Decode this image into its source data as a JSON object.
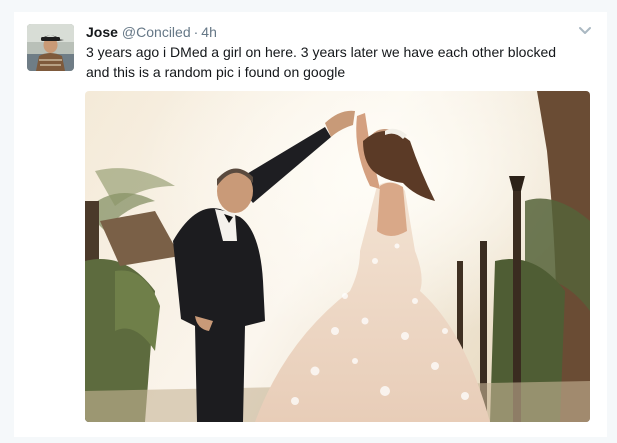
{
  "tweet": {
    "author_name": "Jose",
    "author_handle": "@Conciled",
    "separator": "·",
    "timestamp": "4h",
    "text_line_1": "3 years ago i DMed a girl on here. 3 years later we have each other blocked",
    "text_line_2": "and this is a random pic i found on google"
  },
  "icons": {
    "menu": "chevron-down-icon"
  },
  "colors": {
    "name": "#14171a",
    "secondary_text": "#657786",
    "chevron": "#aab8c2",
    "background": "#f5f8fa"
  }
}
